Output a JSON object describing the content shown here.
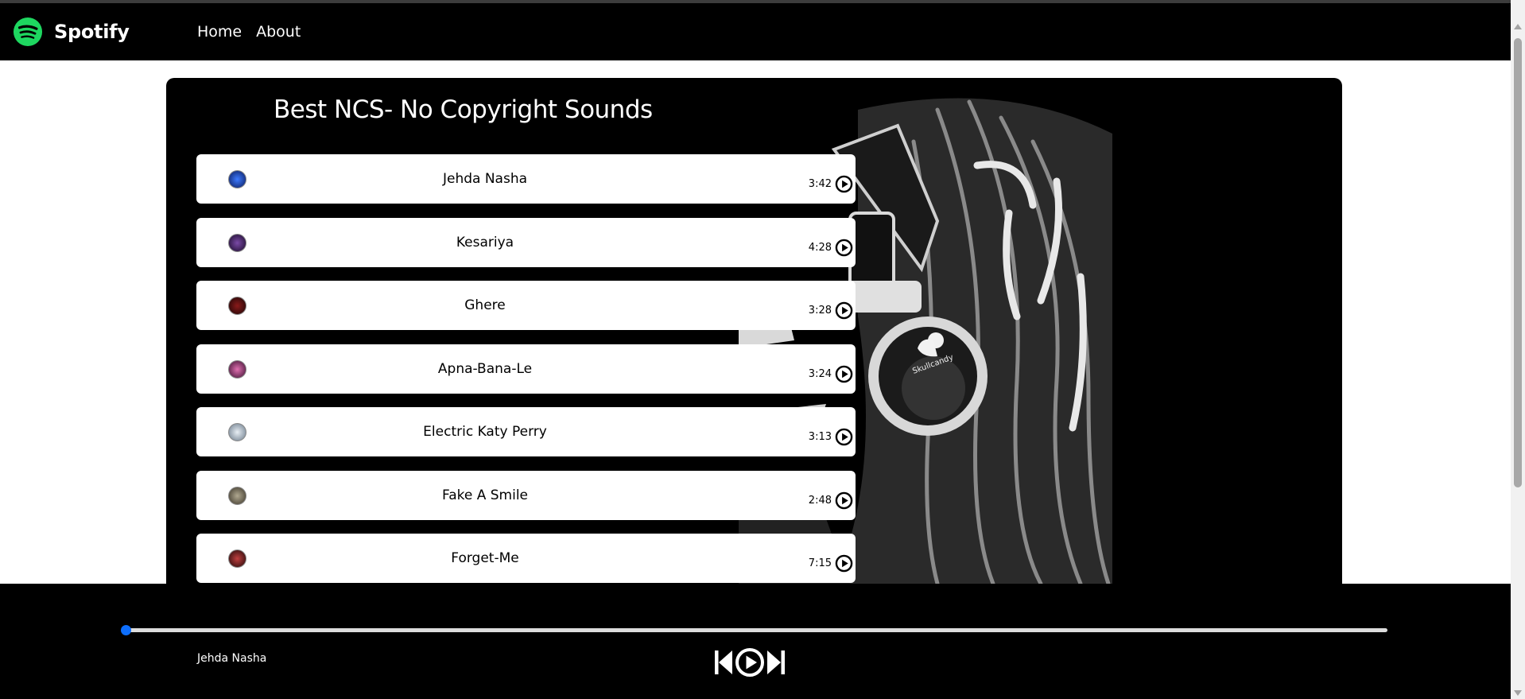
{
  "navbar": {
    "brand_name": "Spotify",
    "links": [
      "Home",
      "About"
    ],
    "logo_icon": "spotify-logo-icon"
  },
  "colors": {
    "brand_green": "#1ed760",
    "progress_blue": "#0d6efd",
    "background": "#000000"
  },
  "playlist": {
    "title": "Best NCS- No Copyright Sounds",
    "songs": [
      {
        "name": "Jehda Nasha",
        "duration": "3:42"
      },
      {
        "name": "Kesariya",
        "duration": "4:28"
      },
      {
        "name": "Ghere",
        "duration": "3:28"
      },
      {
        "name": "Apna-Bana-Le",
        "duration": "3:24"
      },
      {
        "name": "Electric Katy Perry",
        "duration": "3:13"
      },
      {
        "name": "Fake A Smile",
        "duration": "2:48"
      },
      {
        "name": "Forget-Me",
        "duration": "7:15"
      }
    ]
  },
  "player": {
    "now_playing": "Jehda Nasha",
    "progress_percent": 0,
    "controls": [
      "previous-icon",
      "play-icon",
      "next-icon"
    ]
  }
}
